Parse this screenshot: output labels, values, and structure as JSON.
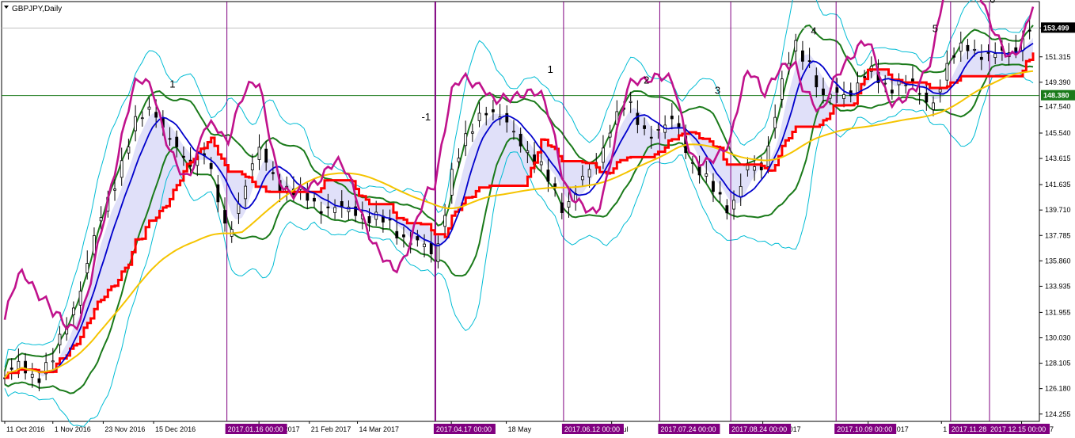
{
  "chart_data": {
    "type": "line",
    "title": "GBPJPY,Daily",
    "colors": {
      "background": "#ffffff",
      "candle": "#000000",
      "cloud_red": "#ff0000",
      "bollinger_outer": "#00bcd4",
      "bollinger_inner": "#1a7a1a",
      "blue_ma": "#0000cc",
      "yellow_ma": "#f5c400",
      "magenta": "#c0128c",
      "marker_line": "#800080",
      "marker_label_bg": "#800080",
      "hline": "#1a7a1a",
      "hline_label_bg": "#1a7a1a",
      "price_label_bg": "#000000"
    },
    "y_axis": {
      "ticks": [
        "153.499",
        "151.315",
        "149.390",
        "147.540",
        "145.540",
        "143.615",
        "141.635",
        "139.710",
        "137.785",
        "135.860",
        "133.935",
        "131.955",
        "130.030",
        "128.105",
        "126.180",
        "124.255"
      ],
      "ylim": [
        123.7,
        155.5
      ],
      "current_price_label": "153.499",
      "current_price_value": 153.499,
      "hline_label": "148.380",
      "hline_value": 148.38
    },
    "x_axis": {
      "ticks": [
        "11 Oct 2016",
        "1 Nov 2016",
        "23 Nov 2016",
        "15 Dec 2016",
        "30 Jan 2017",
        "21 Feb 2017",
        "14 Mar 2017",
        "Apr 2017",
        "18 May",
        "3 Jul",
        "7 Sep 2017",
        "23 Oct 2017",
        "1",
        "Dec 2017"
      ]
    },
    "vertical_markers": [
      {
        "label": "2017.01.16 00:00"
      },
      {
        "label": "2017.04.17 00:00"
      },
      {
        "label": "2017.06.12 00:00"
      },
      {
        "label": "2017.07.24 00:00"
      },
      {
        "label": "2017.08.24 00:00"
      },
      {
        "label": "2017.10.09 00:00"
      },
      {
        "label": "2017.11.28 00:00"
      },
      {
        "label": "2017.12.15 00:00"
      }
    ],
    "wave_labels": [
      "1",
      "-1",
      "1",
      "2",
      "3",
      "4",
      "5",
      "6"
    ],
    "price_series": [
      {
        "date": "2016-10-11",
        "close": 127.0
      },
      {
        "date": "2016-10-18",
        "close": 127.8
      },
      {
        "date": "2016-10-25",
        "close": 127.2
      },
      {
        "date": "2016-11-01",
        "close": 128.2
      },
      {
        "date": "2016-11-08",
        "close": 131.5
      },
      {
        "date": "2016-11-15",
        "close": 135.0
      },
      {
        "date": "2016-11-23",
        "close": 139.5
      },
      {
        "date": "2016-11-30",
        "close": 143.0
      },
      {
        "date": "2016-12-07",
        "close": 146.0
      },
      {
        "date": "2016-12-15",
        "close": 147.8
      },
      {
        "date": "2016-12-22",
        "close": 145.0
      },
      {
        "date": "2016-12-29",
        "close": 143.0
      },
      {
        "date": "2017-01-06",
        "close": 144.5
      },
      {
        "date": "2017-01-16",
        "close": 137.5
      },
      {
        "date": "2017-01-23",
        "close": 141.5
      },
      {
        "date": "2017-01-30",
        "close": 144.0
      },
      {
        "date": "2017-02-07",
        "close": 142.0
      },
      {
        "date": "2017-02-14",
        "close": 141.0
      },
      {
        "date": "2017-02-21",
        "close": 140.5
      },
      {
        "date": "2017-02-28",
        "close": 140.0
      },
      {
        "date": "2017-03-07",
        "close": 139.5
      },
      {
        "date": "2017-03-14",
        "close": 139.8
      },
      {
        "date": "2017-03-21",
        "close": 139.0
      },
      {
        "date": "2017-03-28",
        "close": 138.5
      },
      {
        "date": "2017-04-04",
        "close": 137.8
      },
      {
        "date": "2017-04-11",
        "close": 136.8
      },
      {
        "date": "2017-04-17",
        "close": 136.2
      },
      {
        "date": "2017-04-24",
        "close": 142.5
      },
      {
        "date": "2017-05-01",
        "close": 145.0
      },
      {
        "date": "2017-05-08",
        "close": 147.8
      },
      {
        "date": "2017-05-18",
        "close": 146.0
      },
      {
        "date": "2017-05-25",
        "close": 145.0
      },
      {
        "date": "2017-06-01",
        "close": 143.0
      },
      {
        "date": "2017-06-12",
        "close": 140.0
      },
      {
        "date": "2017-06-19",
        "close": 141.5
      },
      {
        "date": "2017-06-26",
        "close": 143.0
      },
      {
        "date": "2017-07-03",
        "close": 146.5
      },
      {
        "date": "2017-07-10",
        "close": 147.5
      },
      {
        "date": "2017-07-17",
        "close": 146.0
      },
      {
        "date": "2017-07-24",
        "close": 145.5
      },
      {
        "date": "2017-07-31",
        "close": 146.5
      },
      {
        "date": "2017-08-07",
        "close": 143.5
      },
      {
        "date": "2017-08-14",
        "close": 141.5
      },
      {
        "date": "2017-08-24",
        "close": 140.0
      },
      {
        "date": "2017-08-31",
        "close": 142.5
      },
      {
        "date": "2017-09-07",
        "close": 143.0
      },
      {
        "date": "2017-09-14",
        "close": 148.5
      },
      {
        "date": "2017-09-21",
        "close": 152.0
      },
      {
        "date": "2017-09-28",
        "close": 151.0
      },
      {
        "date": "2017-10-03",
        "close": 148.0
      },
      {
        "date": "2017-10-09",
        "close": 148.3
      },
      {
        "date": "2017-10-16",
        "close": 149.0
      },
      {
        "date": "2017-10-23",
        "close": 150.0
      },
      {
        "date": "2017-10-30",
        "close": 149.2
      },
      {
        "date": "2017-11-06",
        "close": 149.5
      },
      {
        "date": "2017-11-13",
        "close": 148.5
      },
      {
        "date": "2017-11-20",
        "close": 148.0
      },
      {
        "date": "2017-11-28",
        "close": 150.8
      },
      {
        "date": "2017-12-05",
        "close": 152.5
      },
      {
        "date": "2017-12-15",
        "close": 151.0
      },
      {
        "date": "2017-12-22",
        "close": 151.8
      },
      {
        "date": "2017-12-29",
        "close": 152.5
      },
      {
        "date": "2018-01-03",
        "close": 153.499
      }
    ]
  }
}
